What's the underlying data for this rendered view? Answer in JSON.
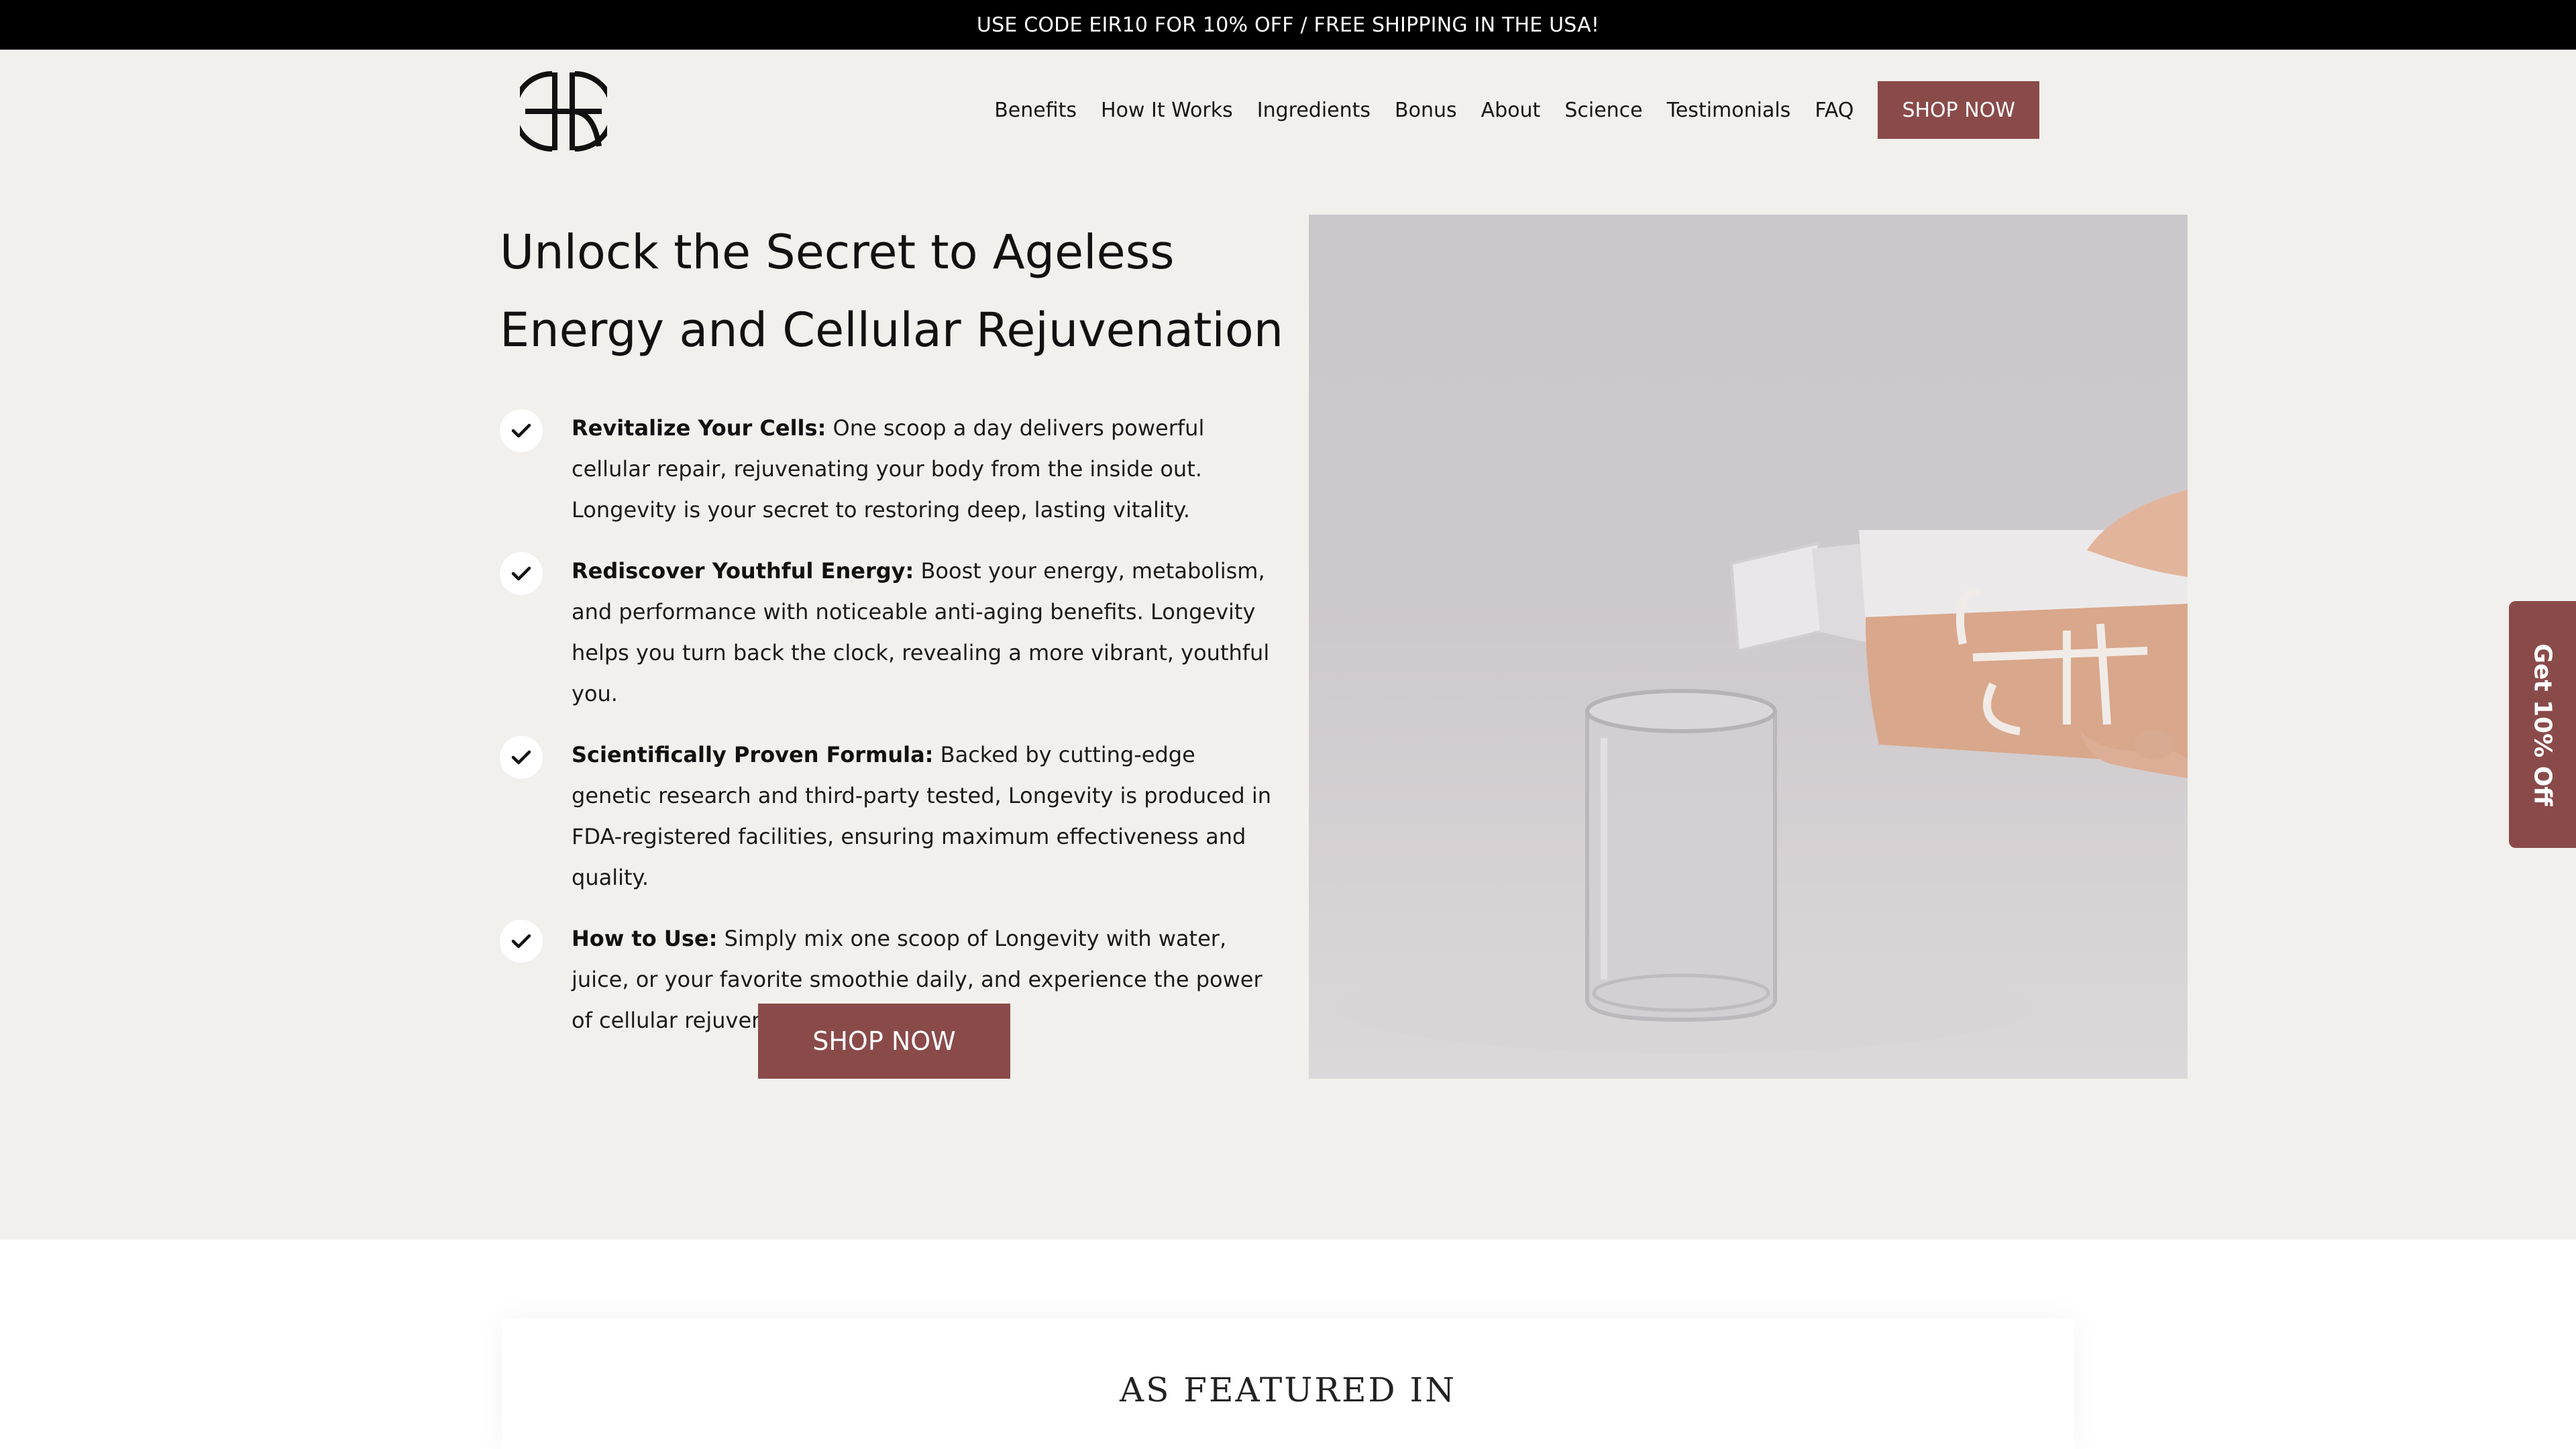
{
  "announcement": {
    "text": "USE CODE EIR10 FOR 10% OFF / FREE SHIPPING IN THE USA!"
  },
  "header": {
    "logo_icon": "eir-monogram-logo",
    "nav": [
      {
        "label": "Benefits"
      },
      {
        "label": "How It Works"
      },
      {
        "label": "Ingredients"
      },
      {
        "label": "Bonus"
      },
      {
        "label": "About"
      },
      {
        "label": "Science"
      },
      {
        "label": "Testimonials"
      },
      {
        "label": "FAQ"
      }
    ],
    "shop_label": "SHOP NOW"
  },
  "hero": {
    "title_line1": "Unlock the Secret to Ageless",
    "title_line2": "Energy and Cellular Rejuvenation",
    "benefits": [
      {
        "title": "Revitalize Your Cells:",
        "text": " One scoop a day delivers powerful cellular repair, rejuvenating your body from the inside out. Longevity is your secret to restoring deep, lasting vitality."
      },
      {
        "title": "Rediscover Youthful Energy:",
        "text": " Boost your energy, metabolism, and performance with noticeable anti-aging benefits. Longevity helps you turn back the clock, revealing a more vibrant, youthful you."
      },
      {
        "title": "Scientifically Proven Formula:",
        "text": " Backed by cutting-edge genetic research and third-party tested, Longevity is produced in FDA-registered facilities, ensuring maximum effectiveness and quality."
      },
      {
        "title": "How to Use:",
        "text": " Simply mix one scoop of Longevity with water, juice, or your favorite smoothie daily, and experience the power of cellular rejuvenation."
      }
    ],
    "shop_label": "SHOP NOW",
    "image_icon": "product-pour-image"
  },
  "side_tab": {
    "label": "Get 10% Off"
  },
  "featured": {
    "title": "AS FEATURED IN"
  },
  "colors": {
    "accent": "#8a4a4a",
    "background": "#f2f0ec",
    "announcement_bg": "#000000"
  }
}
